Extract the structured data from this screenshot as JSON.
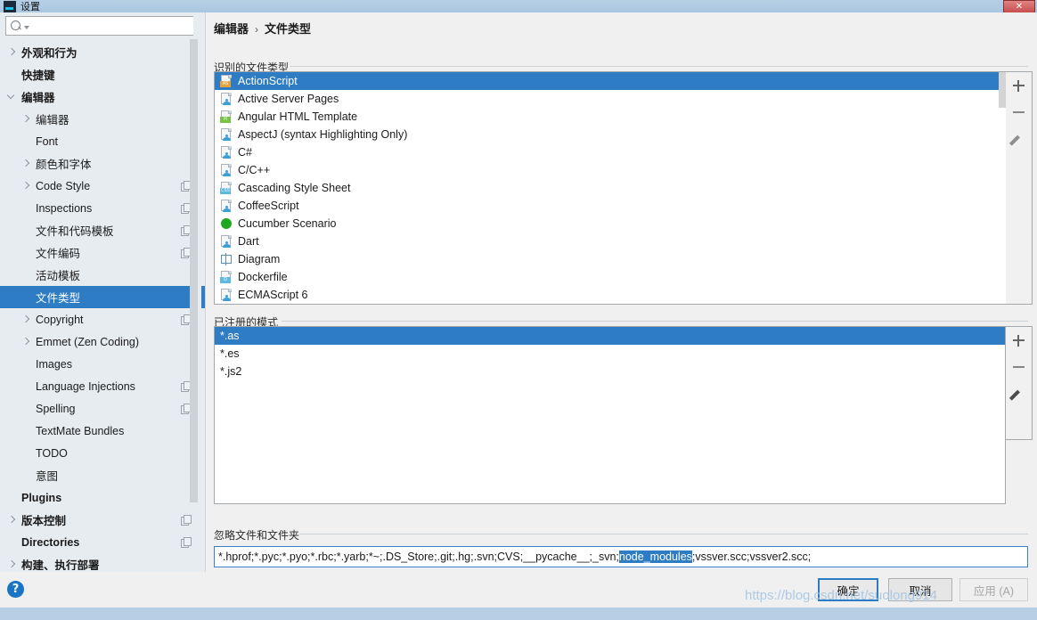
{
  "window": {
    "title": "设置",
    "close_label": "✕",
    "app_icon": "app-icon"
  },
  "sidebar": {
    "search": {
      "value": "",
      "placeholder": ""
    },
    "items": [
      {
        "label": "外观和行为",
        "indent": 0,
        "arrow": "collapsed",
        "bold": true,
        "copy": false,
        "selected": false
      },
      {
        "label": "快捷键",
        "indent": 0,
        "arrow": "none",
        "bold": true,
        "copy": false,
        "selected": false
      },
      {
        "label": "编辑器",
        "indent": 0,
        "arrow": "expanded",
        "bold": true,
        "copy": false,
        "selected": false
      },
      {
        "label": "编辑器",
        "indent": 1,
        "arrow": "collapsed",
        "bold": false,
        "copy": false,
        "selected": false
      },
      {
        "label": "Font",
        "indent": 1,
        "arrow": "none",
        "bold": false,
        "copy": false,
        "selected": false
      },
      {
        "label": "颜色和字体",
        "indent": 1,
        "arrow": "collapsed",
        "bold": false,
        "copy": false,
        "selected": false
      },
      {
        "label": "Code Style",
        "indent": 1,
        "arrow": "collapsed",
        "bold": false,
        "copy": true,
        "selected": false
      },
      {
        "label": "Inspections",
        "indent": 1,
        "arrow": "none",
        "bold": false,
        "copy": true,
        "selected": false
      },
      {
        "label": "文件和代码模板",
        "indent": 1,
        "arrow": "none",
        "bold": false,
        "copy": true,
        "selected": false
      },
      {
        "label": "文件编码",
        "indent": 1,
        "arrow": "none",
        "bold": false,
        "copy": true,
        "selected": false
      },
      {
        "label": "活动模板",
        "indent": 1,
        "arrow": "none",
        "bold": false,
        "copy": false,
        "selected": false
      },
      {
        "label": "文件类型",
        "indent": 1,
        "arrow": "none",
        "bold": false,
        "copy": false,
        "selected": true
      },
      {
        "label": "Copyright",
        "indent": 1,
        "arrow": "collapsed",
        "bold": false,
        "copy": true,
        "selected": false
      },
      {
        "label": "Emmet (Zen Coding)",
        "indent": 1,
        "arrow": "collapsed",
        "bold": false,
        "copy": false,
        "selected": false
      },
      {
        "label": "Images",
        "indent": 1,
        "arrow": "none",
        "bold": false,
        "copy": false,
        "selected": false
      },
      {
        "label": "Language Injections",
        "indent": 1,
        "arrow": "none",
        "bold": false,
        "copy": true,
        "selected": false
      },
      {
        "label": "Spelling",
        "indent": 1,
        "arrow": "none",
        "bold": false,
        "copy": true,
        "selected": false
      },
      {
        "label": "TextMate Bundles",
        "indent": 1,
        "arrow": "none",
        "bold": false,
        "copy": false,
        "selected": false
      },
      {
        "label": "TODO",
        "indent": 1,
        "arrow": "none",
        "bold": false,
        "copy": false,
        "selected": false
      },
      {
        "label": "意图",
        "indent": 1,
        "arrow": "none",
        "bold": false,
        "copy": false,
        "selected": false
      },
      {
        "label": "Plugins",
        "indent": 0,
        "arrow": "none",
        "bold": true,
        "copy": false,
        "selected": false
      },
      {
        "label": "版本控制",
        "indent": 0,
        "arrow": "collapsed",
        "bold": true,
        "copy": true,
        "selected": false
      },
      {
        "label": "Directories",
        "indent": 0,
        "arrow": "none",
        "bold": true,
        "copy": true,
        "selected": false
      },
      {
        "label": "构建、执行部署",
        "indent": 0,
        "arrow": "collapsed",
        "bold": true,
        "copy": false,
        "selected": false
      }
    ]
  },
  "content": {
    "breadcrumb": {
      "parent": "编辑器",
      "separator": "›",
      "current": "文件类型"
    },
    "recognized": {
      "group_label": "识别的文件类型",
      "items": [
        {
          "label": "ActionScript",
          "icon": "file-as-icon",
          "badge": "AS",
          "badge_color": "#e8a33d",
          "selected": true
        },
        {
          "label": "Active Server Pages",
          "icon": "file-person-icon",
          "badge": "",
          "badge_color": "",
          "selected": false
        },
        {
          "label": "Angular HTML Template",
          "icon": "file-h-icon",
          "badge": "H",
          "badge_color": "#79c24a",
          "selected": false
        },
        {
          "label": "AspectJ (syntax Highlighting Only)",
          "icon": "file-person-icon",
          "badge": "",
          "badge_color": "",
          "selected": false
        },
        {
          "label": "C#",
          "icon": "file-person-icon",
          "badge": "",
          "badge_color": "",
          "selected": false
        },
        {
          "label": "C/C++",
          "icon": "file-person-icon",
          "badge": "",
          "badge_color": "",
          "selected": false
        },
        {
          "label": "Cascading Style Sheet",
          "icon": "file-css-icon",
          "badge": "CSS",
          "badge_color": "#5fb8e0",
          "selected": false
        },
        {
          "label": "CoffeeScript",
          "icon": "file-coffee-icon",
          "badge": "",
          "badge_color": "",
          "selected": false
        },
        {
          "label": "Cucumber Scenario",
          "icon": "cucumber-icon",
          "badge": "",
          "badge_color": "#1ea81e",
          "selected": false
        },
        {
          "label": "Dart",
          "icon": "file-dart-icon",
          "badge": "",
          "badge_color": "",
          "selected": false
        },
        {
          "label": "Diagram",
          "icon": "diagram-icon",
          "badge": "",
          "badge_color": "",
          "selected": false
        },
        {
          "label": "Dockerfile",
          "icon": "file-d-icon",
          "badge": "D",
          "badge_color": "#5fb8e0",
          "selected": false
        },
        {
          "label": "ECMAScript 6",
          "icon": "file-es-icon",
          "badge": "",
          "badge_color": "",
          "selected": false
        }
      ],
      "buttons": {
        "add": "+",
        "remove": "−",
        "edit": "pencil"
      }
    },
    "patterns": {
      "group_label": "已注册的模式",
      "items": [
        {
          "label": "*.as",
          "selected": true
        },
        {
          "label": "*.es",
          "selected": false
        },
        {
          "label": "*.js2",
          "selected": false
        }
      ],
      "buttons": {
        "add": "+",
        "remove": "−",
        "edit": "pencil"
      }
    },
    "ignore": {
      "group_label": "忽略文件和文件夹",
      "value_before": "*.hprof;*.pyc;*.pyo;*.rbc;*.yarb;*~;.DS_Store;.git;.hg;.svn;CVS;__pycache__;_svn;",
      "value_selected": "node_modules",
      "value_after": ";vssver.scc;vssver2.scc;"
    }
  },
  "footer": {
    "help": "?",
    "ok": "确定",
    "cancel": "取消",
    "apply": "应用 (A)"
  },
  "watermark": "https://blog.csdn.net/suolong914",
  "colors": {
    "accent": "#2d7cc4",
    "titlebar": "#b6cfe5",
    "sidebar_bg": "#e7ecf0",
    "panel_bg": "#ffffff"
  }
}
